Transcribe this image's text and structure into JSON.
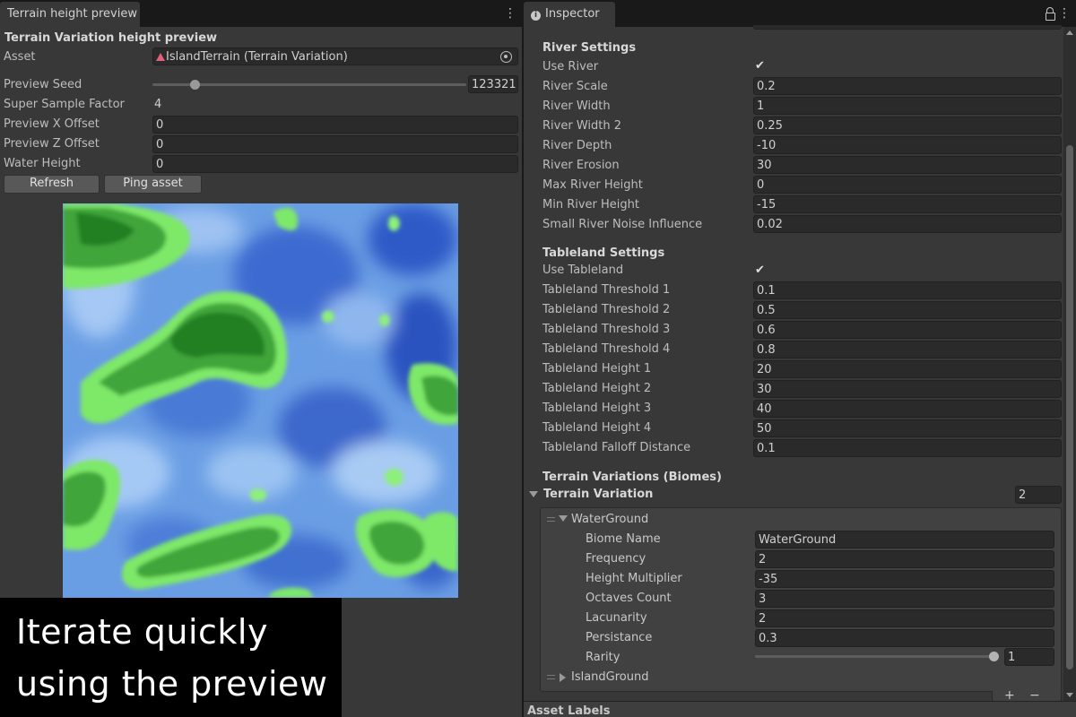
{
  "left_panel": {
    "tab_title": "Terrain height preview",
    "heading": "Terrain Variation height preview",
    "asset_label": "Asset",
    "asset_value": "IslandTerrain (Terrain Variation)",
    "preview_seed_label": "Preview Seed",
    "preview_seed_value": "123321",
    "super_sample_label": "Super Sample Factor",
    "super_sample_value": "4",
    "x_offset_label": "Preview X Offset",
    "x_offset_value": "0",
    "z_offset_label": "Preview Z Offset",
    "z_offset_value": "0",
    "water_height_label": "Water Height",
    "water_height_value": "0",
    "refresh_button": "Refresh",
    "ping_button": "Ping asset"
  },
  "caption": {
    "line1": "Iterate quickly",
    "line2": "using the preview"
  },
  "inspector": {
    "tab_title": "Inspector",
    "river": {
      "header": "River Settings",
      "use_river_label": "Use River",
      "rows": [
        {
          "label": "River Scale",
          "value": "0.2"
        },
        {
          "label": "River Width",
          "value": "1"
        },
        {
          "label": "River Width 2",
          "value": "0.25"
        },
        {
          "label": "River Depth",
          "value": "-10"
        },
        {
          "label": "River Erosion",
          "value": "30"
        },
        {
          "label": "Max River Height",
          "value": "0"
        },
        {
          "label": "Min River Height",
          "value": "-15"
        },
        {
          "label": "Small River Noise Influence",
          "value": "0.02"
        }
      ]
    },
    "tableland": {
      "header": "Tableland Settings",
      "use_tableland_label": "Use Tableland",
      "rows": [
        {
          "label": "Tableland Threshold 1",
          "value": "0.1"
        },
        {
          "label": "Tableland Threshold 2",
          "value": "0.5"
        },
        {
          "label": "Tableland Threshold 3",
          "value": "0.6"
        },
        {
          "label": "Tableland Threshold 4",
          "value": "0.8"
        },
        {
          "label": "Tableland Height 1",
          "value": "20"
        },
        {
          "label": "Tableland Height 2",
          "value": "30"
        },
        {
          "label": "Tableland Height 3",
          "value": "40"
        },
        {
          "label": "Tableland Height 4",
          "value": "50"
        },
        {
          "label": "Tableland Falloff Distance",
          "value": "0.1"
        }
      ]
    },
    "variations": {
      "header": "Terrain Variations (Biomes)",
      "list_label": "Terrain Variation",
      "count": "2",
      "element0": {
        "name": "WaterGround",
        "rows": [
          {
            "label": "Biome Name",
            "value": "WaterGround"
          },
          {
            "label": "Frequency",
            "value": "2"
          },
          {
            "label": "Height Multiplier",
            "value": "-35"
          },
          {
            "label": "Octaves Count",
            "value": "3"
          },
          {
            "label": "Lacunarity",
            "value": "2"
          },
          {
            "label": "Persistance",
            "value": "0.3"
          }
        ],
        "rarity_label": "Rarity",
        "rarity_value": "1"
      },
      "element1": {
        "name": "IslandGround"
      },
      "add_symbol": "+",
      "remove_symbol": "−"
    },
    "asset_labels": "Asset Labels"
  }
}
